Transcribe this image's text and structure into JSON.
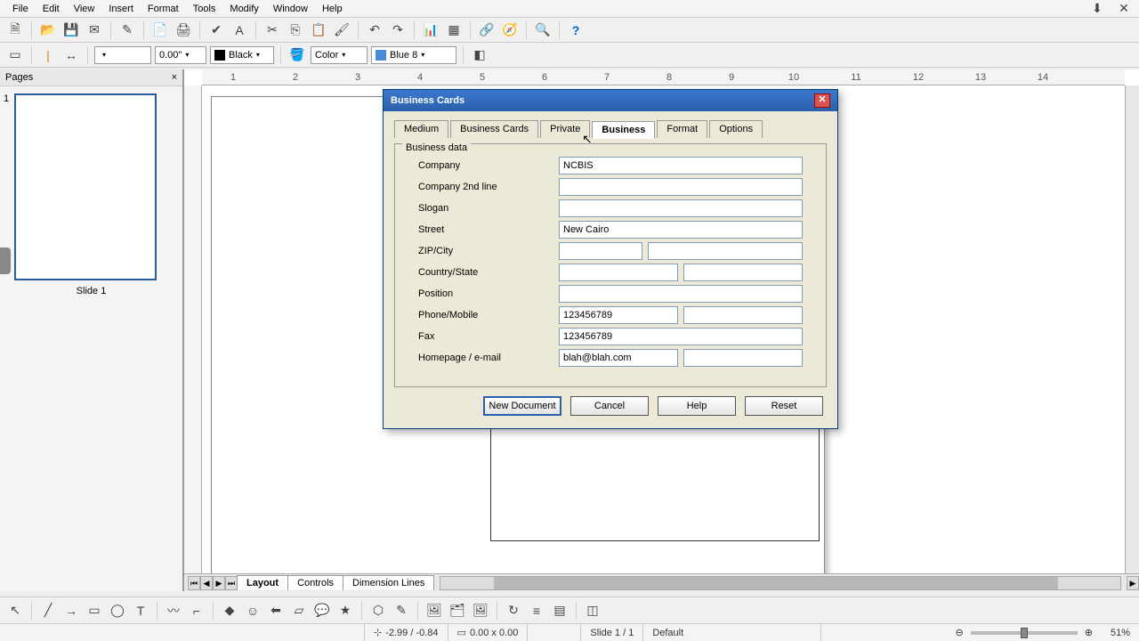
{
  "menu": {
    "items": [
      "File",
      "Edit",
      "View",
      "Insert",
      "Format",
      "Tools",
      "Modify",
      "Window",
      "Help"
    ]
  },
  "toolbar2": {
    "width_combo": "",
    "size_combo": "0.00\"",
    "color_combo": "Black",
    "fill_type": "Color",
    "fill_color": "Blue 8"
  },
  "pages": {
    "title": "Pages",
    "slide_num": "1",
    "slide_label": "Slide 1"
  },
  "ruler": [
    "1",
    "2",
    "3",
    "4",
    "5",
    "6",
    "7",
    "8",
    "9",
    "10",
    "11",
    "12",
    "13",
    "14"
  ],
  "tabs": {
    "layout": "Layout",
    "controls": "Controls",
    "dimension": "Dimension Lines"
  },
  "dialog": {
    "title": "Business Cards",
    "tabs": [
      "Medium",
      "Business Cards",
      "Private",
      "Business",
      "Format",
      "Options"
    ],
    "active_tab": 3,
    "group": "Business data",
    "labels": {
      "company": "Company",
      "company2": "Company 2nd line",
      "slogan": "Slogan",
      "street": "Street",
      "zipcity": "ZIP/City",
      "countrystate": "Country/State",
      "position": "Position",
      "phonemobile": "Phone/Mobile",
      "fax": "Fax",
      "homepageemail": "Homepage / e-mail"
    },
    "values": {
      "company": "NCBIS",
      "company2": "",
      "slogan": "",
      "street": "New Cairo",
      "zip": "",
      "city": "",
      "country": "",
      "state": "",
      "position": "",
      "phone": "123456789",
      "mobile": "",
      "fax": "123456789",
      "homepage": "blah@blah.com",
      "email": ""
    },
    "buttons": {
      "newdoc": "New Document",
      "cancel": "Cancel",
      "help": "Help",
      "reset": "Reset"
    }
  },
  "status": {
    "coords": "-2.99 / -0.84",
    "size": "0.00 x 0.00",
    "slide": "Slide 1 / 1",
    "layout": "Default",
    "zoom": "51%"
  }
}
